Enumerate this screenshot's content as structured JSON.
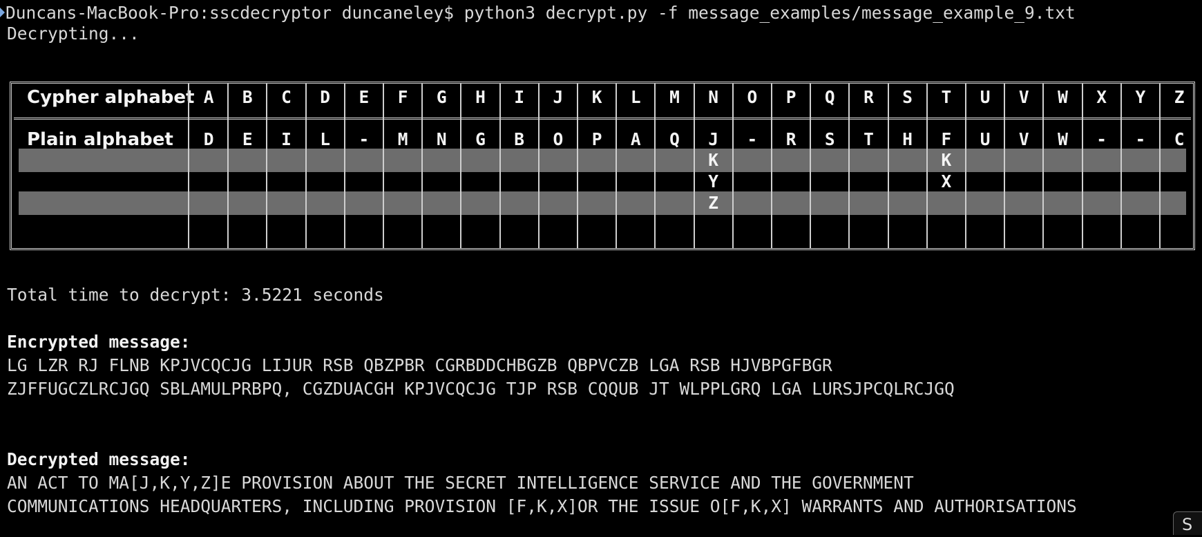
{
  "terminal": {
    "command_line": "Duncans-MacBook-Pro:sscdecryptor duncaneley$ python3 decrypt.py -f message_examples/message_example_9.txt",
    "status": "Decrypting...",
    "total_time": "Total time to decrypt: 3.5221 seconds",
    "encrypted_heading": "Encrypted message:",
    "encrypted_lines": [
      "LG LZR RJ FLNB KPJVCQCJG LIJUR RSB QBZPBR CGRBDDCHBGZB QBPVCZB LGA RSB HJVBPGFBGR",
      "ZJFFUGCZLRCJGQ SBLAMULPRBPQ, CGZDUACGH KPJVCQCJG TJP RSB CQQUB JT WLPPLGRQ LGA LURSJPCQLRCJGQ"
    ],
    "decrypted_heading": "Decrypted message:",
    "decrypted_lines": [
      "AN ACT TO MA[J,K,Y,Z]E PROVISION ABOUT THE SECRET INTELLIGENCE SERVICE AND THE GOVERNMENT",
      "COMMUNICATIONS HEADQUARTERS, INCLUDING PROVISION [F,K,X]OR THE ISSUE O[F,K,X] WARRANTS AND AUTHORISATIONS"
    ],
    "corner_button_label": "S"
  },
  "alphabet_table": {
    "cypher_label": "Cypher alphabet",
    "plain_label": "Plain alphabet",
    "cypher": [
      "A",
      "B",
      "C",
      "D",
      "E",
      "F",
      "G",
      "H",
      "I",
      "J",
      "K",
      "L",
      "M",
      "N",
      "O",
      "P",
      "Q",
      "R",
      "S",
      "T",
      "U",
      "V",
      "W",
      "X",
      "Y",
      "Z"
    ],
    "plain": [
      "D",
      "E",
      "I",
      "L",
      "-",
      "M",
      "N",
      "G",
      "B",
      "O",
      "P",
      "A",
      "Q",
      "J",
      "-",
      "R",
      "S",
      "T",
      "H",
      "F",
      "U",
      "V",
      "W",
      "-",
      "-",
      "C"
    ],
    "alternates": {
      "N": [
        "K",
        "Y",
        "Z"
      ],
      "T": [
        "K",
        "X"
      ]
    }
  },
  "colors": {
    "background": "#000000",
    "text": "#d8d8d8",
    "stripe": "#6d6d6d",
    "prompt_marker": "#7aa7e0"
  }
}
